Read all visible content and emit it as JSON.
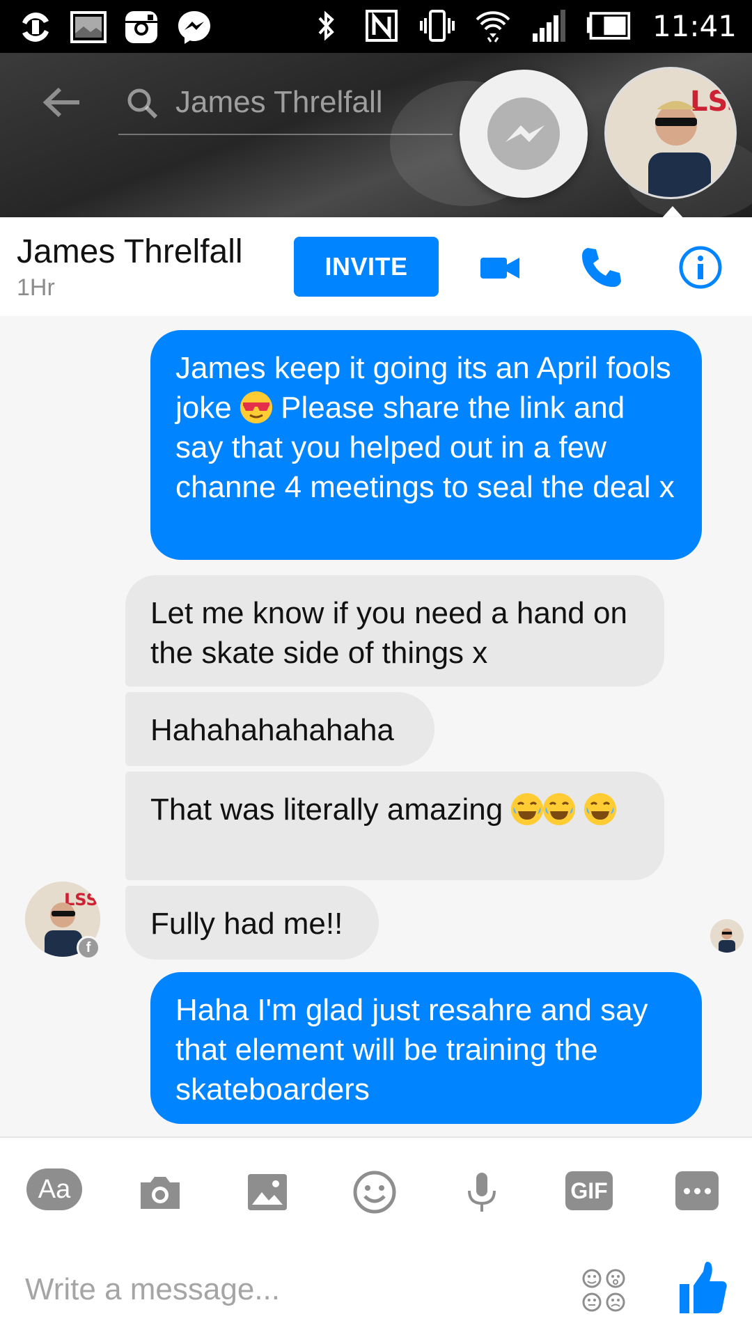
{
  "status_bar": {
    "time": "11:41",
    "left_icons": [
      "sync-icon",
      "gallery-icon",
      "instagram-icon",
      "messenger-icon"
    ],
    "right_icons": [
      "bluetooth-icon",
      "nfc-icon",
      "vibrate-icon",
      "wifi-icon",
      "signal-icon",
      "battery-icon"
    ]
  },
  "header": {
    "search_text": "James Threlfall"
  },
  "contact": {
    "name": "James Threlfall",
    "status": "1Hr",
    "invite_label": "INVITE"
  },
  "messages": [
    {
      "direction": "outgoing",
      "text_before": "James keep it going its an April fools joke ",
      "emoji": "sunglasses",
      "text_after": " Please share the link and say that you helped out in a few channe 4 meetings to seal the deal x"
    },
    {
      "direction": "incoming",
      "text": "Let me know if you need a hand on the skate side of things x"
    },
    {
      "direction": "incoming",
      "text": "Hahahahahahaha"
    },
    {
      "direction": "incoming",
      "text": "That was literally amazing",
      "emoji": "tears-of-joy",
      "emoji_count": 3
    },
    {
      "direction": "incoming",
      "text": "Fully had me!!"
    },
    {
      "direction": "outgoing",
      "text": "Haha I'm glad just resahre and say that element will be training the skateboarders"
    }
  ],
  "composer": {
    "aa_label": "Aa",
    "gif_label": "GIF",
    "placeholder": "Write a message..."
  },
  "colors": {
    "accent": "#0084ff",
    "incoming_bubble": "#e8e8e8",
    "background": "#f6f6f6"
  }
}
